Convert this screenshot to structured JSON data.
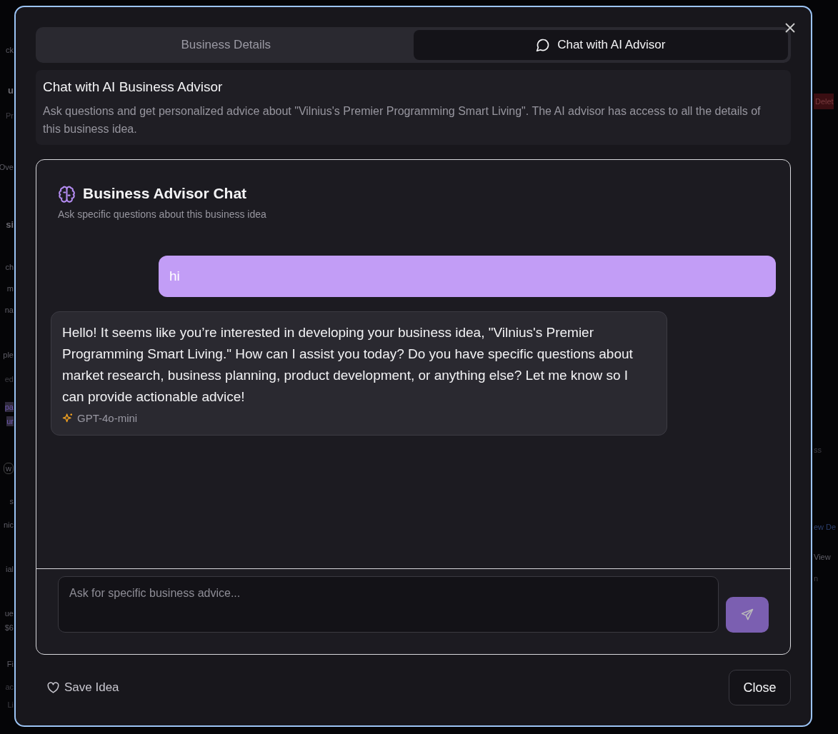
{
  "background": {
    "left_fragments": [
      {
        "text": "ck",
        "kind": "text"
      },
      {
        "text": "u",
        "kind": "large"
      },
      {
        "text": "Pr",
        "kind": "muted"
      },
      {
        "text": "Ove",
        "kind": "text"
      },
      {
        "text": "si",
        "kind": "large"
      },
      {
        "text": "ch",
        "kind": "text"
      },
      {
        "text": "m",
        "kind": "text"
      },
      {
        "text": "na",
        "kind": "text"
      },
      {
        "text": "ple",
        "kind": "text"
      },
      {
        "text": "ed",
        "kind": "muted"
      },
      {
        "text": "pa",
        "kind": "highlight"
      },
      {
        "text": "ur",
        "kind": "highlight"
      },
      {
        "text": "w",
        "kind": "pill"
      },
      {
        "text": "s",
        "kind": "text"
      },
      {
        "text": "nic",
        "kind": "text"
      },
      {
        "text": "ial",
        "kind": "text"
      },
      {
        "text": "ue",
        "kind": "text"
      },
      {
        "text": "$6",
        "kind": "text"
      },
      {
        "text": "Fi",
        "kind": "text"
      },
      {
        "text": "ac",
        "kind": "muted"
      },
      {
        "text": "Li",
        "kind": "muted"
      }
    ],
    "right_fragments": [
      {
        "text": "Delet",
        "kind": "danger"
      },
      {
        "text": "ss",
        "kind": "muted"
      },
      {
        "text": "ew De",
        "kind": "link"
      },
      {
        "text": "View",
        "kind": "text"
      },
      {
        "text": "n",
        "kind": "muted"
      }
    ]
  },
  "tabs": [
    {
      "label": "Business Details",
      "selected": false,
      "kind": "plain"
    },
    {
      "label": "Chat with AI Advisor",
      "selected": true,
      "kind": "chat"
    }
  ],
  "intro": {
    "title": "Chat with AI Business Advisor",
    "description": "Ask questions and get personalized advice about \"Vilnius's Premier Programming Smart Living\". The AI advisor has access to all the details of this business idea."
  },
  "chat": {
    "title": "Business Advisor Chat",
    "subtitle": "Ask specific questions about this business idea",
    "messages": [
      {
        "kind": "user",
        "text": "hi"
      },
      {
        "kind": "assistant",
        "text": "Hello! It seems like you’re interested in developing your business idea, \"Vilnius's Premier Programming Smart Living.\" How can I assist you today? Do you have specific questions about market research, business planning, product development, or anything else? Let me know so I can provide actionable advice!",
        "model": "GPT-4o-mini"
      }
    ],
    "input": {
      "placeholder": "Ask for specific business advice..."
    },
    "send_button": {
      "disabled": true
    }
  },
  "footer": {
    "save_label": "Save Idea",
    "close_label": "Close"
  }
}
